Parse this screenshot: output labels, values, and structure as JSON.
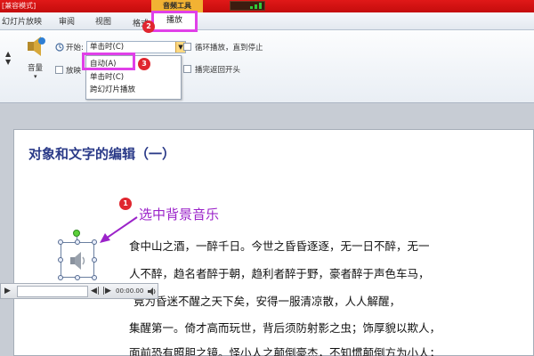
{
  "window": {
    "title": "[兼容模式]"
  },
  "ribbon_tabs": {
    "items": [
      {
        "label": "幻灯片放映"
      },
      {
        "label": "审阅"
      },
      {
        "label": "视图"
      },
      {
        "label": "格式"
      }
    ],
    "context_group": "音频工具",
    "active_tab": "播放"
  },
  "ribbon": {
    "volume_label": "音量",
    "start_label": "开始:",
    "start_value": "单击时(C)",
    "hide_label": "放映",
    "loop_label": "循环播放，直到停止",
    "rewind_label": "播完返回开头"
  },
  "start_dropdown": {
    "options": [
      {
        "label": "自动(A)"
      },
      {
        "label": "单击时(C)"
      },
      {
        "label": "跨幻灯片播放"
      }
    ]
  },
  "steps": {
    "one": "1",
    "two": "2",
    "three": "3"
  },
  "slide": {
    "title": "对象和文字的编辑（一）",
    "annotation": "选中背景音乐",
    "body": [
      {
        "text": "食中山之酒，一醉千日。今世之昏昏逐逐，无一日不醉，无一"
      },
      {
        "text": "人不醉，趋名者醉于朝，趋利者醉于野，豪者醉于声色车马，"
      },
      {
        "text": "竟为昏迷不醒之天下矣，安得一服清凉散，人人解醒，"
      },
      {
        "text": "集醒第一。倚才高而玩世，背后须防射影之虫；饰厚貌以欺人，"
      },
      {
        "text": "面前恐有照胆之镜。怪小人之颠倒豪杰，不知惯颠倒方为小人；"
      }
    ]
  },
  "player": {
    "time": "00:00.00"
  },
  "colors": {
    "title_bar": "#d41414",
    "highlight_box": "#e040e8",
    "step_badge": "#e0262f",
    "annotation": "#9b23c9",
    "slide_title": "#2a3a88"
  },
  "icons": {
    "speaker": "speaker-icon",
    "play": "play-icon",
    "arrow": "annotation-arrow-icon"
  }
}
